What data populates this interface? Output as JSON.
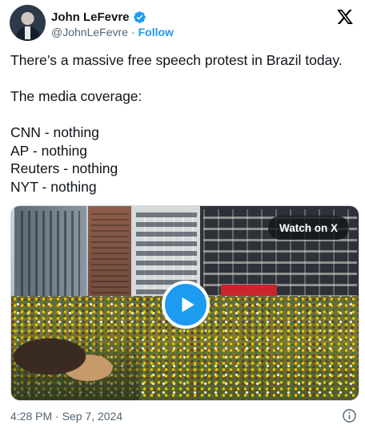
{
  "author": {
    "name": "John LeFevre",
    "handle": "@JohnLeFevre",
    "separator": "·",
    "follow_label": "Follow",
    "verified_icon": "verified-badge-icon",
    "verified_color": "#1d9bf0"
  },
  "brand": {
    "logo_icon": "x-logo-icon",
    "color": "#000000"
  },
  "tweet": {
    "text": "There’s a massive free speech protest in Brazil today.\n\nThe media coverage:\n\nCNN - nothing\nAP - nothing\nReuters - nothing\nNYT - nothing"
  },
  "media": {
    "watch_label": "Watch on X",
    "play_icon": "play-icon",
    "play_color": "#1d9bf0"
  },
  "footer": {
    "timestamp": "4:28 PM · Sep 7, 2024",
    "info_icon": "info-icon"
  },
  "colors": {
    "accent": "#1d9bf0",
    "secondary_text": "#536471",
    "primary_text": "#0f1419"
  }
}
